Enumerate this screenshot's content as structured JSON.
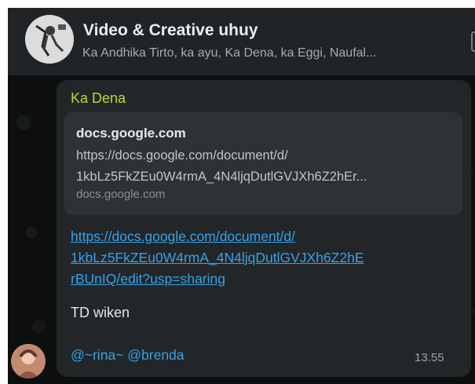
{
  "header": {
    "title": "Video & Creative uhuy",
    "members": "Ka Andhika Tirto, ka ayu, Ka Dena, ka Eggi, Naufal..."
  },
  "message": {
    "sender": "Ka Dena",
    "preview": {
      "domain": "docs.google.com",
      "url_lines": [
        "https://docs.google.com/document/d/",
        "1kbLz5FkZEu0W4rmA_4N4ljqDutlGVJXh6Z2hEr..."
      ],
      "site": "docs.google.com"
    },
    "link_lines": [
      "https://docs.google.com/document/d/",
      "1kbLz5FkZEu0W4rmA_4N4ljqDutlGVJXh6Z2hE",
      "rBUnIQ/edit?usp=sharing"
    ],
    "text": "TD wiken",
    "mentions": [
      "@~rina~",
      "@brenda"
    ],
    "time": "13.55"
  },
  "colors": {
    "sender_name": "#b7dd2b",
    "link": "#35a3ea",
    "bubble": "#232628",
    "preview_card": "#2f3235",
    "header": "#202426"
  },
  "icons": {
    "group_avatar": "group-avatar-image",
    "sender_avatar": "sender-avatar-image"
  }
}
